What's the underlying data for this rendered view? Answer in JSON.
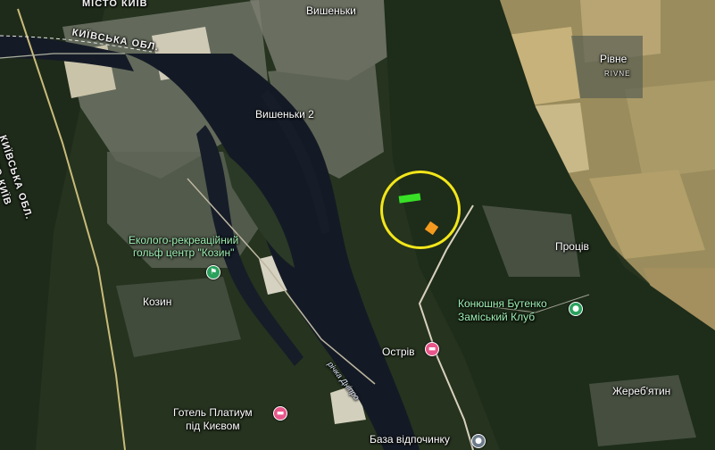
{
  "map": {
    "type": "satellite",
    "colors": {
      "forest": "#22361f",
      "water": "#1a1f2e",
      "field": "#b8a26c",
      "sand": "#d9d6c6",
      "highlight_ring": "#f3e61a",
      "marker_green": "#38e026",
      "marker_orange": "#f59a1e"
    }
  },
  "labels": {
    "misto_kyiv_top": "МІСТО КИЇВ",
    "kyivska_obl_top": "КИЇВСЬКА ОБЛ.",
    "kyivska_obl_vertical": "КИЇВСЬКА ОБЛ.",
    "misto_kyiv_vertical": "МІСТО КИЇВ",
    "vyshenky": "Вишеньки",
    "vyshenky_2": "Вишеньки 2",
    "rivne": "Рівне",
    "rivne_latin": "RIVNE",
    "golf_line1": "Еколого-рекреаційний",
    "golf_line2": "гольф центр \"Козин\"",
    "kozyn": "Козин",
    "protsiv": "Проців",
    "stable_line1": "Конюшня Бутенко",
    "stable_line2": "Заміський Клуб",
    "ostriv": "Острів",
    "river": "річка Дніпро",
    "hotel_line1": "Готель Платиум",
    "hotel_line2": "під Києвом",
    "rest_base": "База відпочинку",
    "zherebiatyn": "Жереб'ятин"
  },
  "icons": {
    "golf": "golf-flag-icon",
    "stable": "park-pin-icon",
    "ostriv": "hotel-bed-icon",
    "hotel": "hotel-bed-icon",
    "rest_base": "place-pin-icon"
  }
}
